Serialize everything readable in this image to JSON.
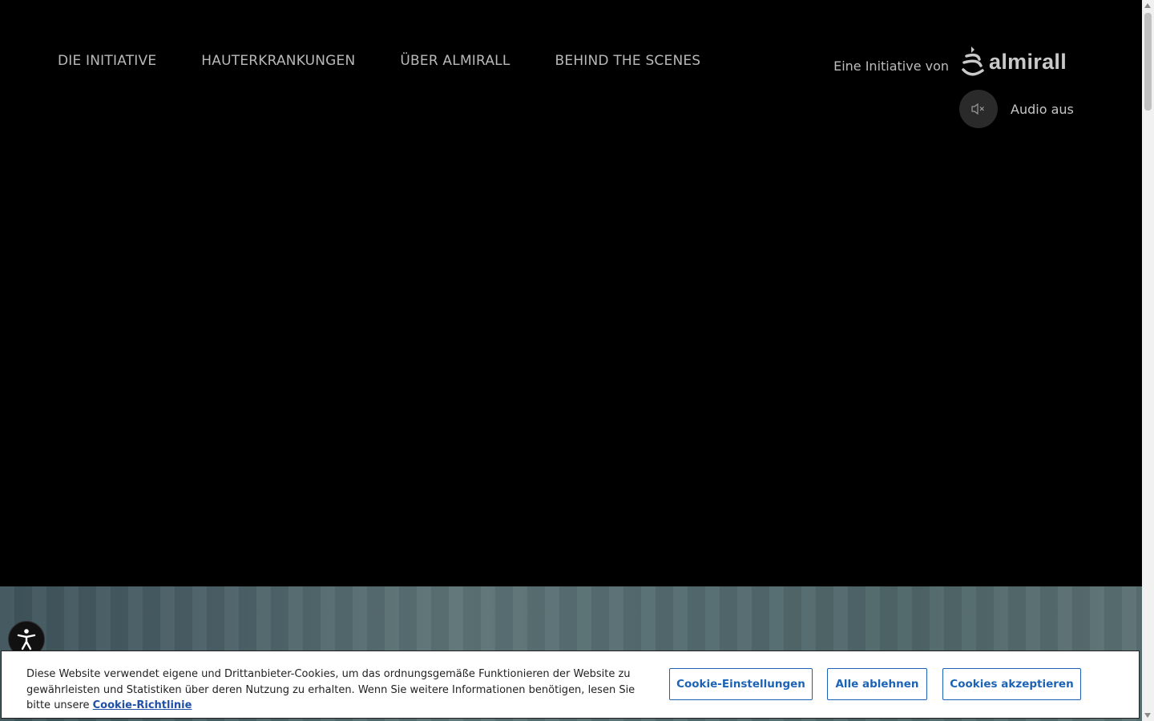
{
  "nav": {
    "items": [
      {
        "label": "DIE INITIATIVE"
      },
      {
        "label": "HAUTERKRANKUNGEN"
      },
      {
        "label": "ÜBER ALMIRALL"
      },
      {
        "label": "BEHIND THE SCENES"
      }
    ]
  },
  "brand": {
    "tagline": "Eine Initiative von",
    "logo_text": "almirall"
  },
  "audio": {
    "label": "Audio aus",
    "icon": "speaker-muted-icon"
  },
  "accessibility": {
    "icon": "accessibility-person-icon"
  },
  "cookie": {
    "text": "Diese Website verwendet eigene und Drittanbieter-Cookies, um das ordnungsgemäße Funktionieren der Website zu gewährleisten und Statistiken über deren Nutzung zu erhalten. Wenn Sie weitere Informationen benötigen, lesen Sie bitte unsere ",
    "link": "Cookie-Richtlinie",
    "settings_label": "Cookie-Einstellungen",
    "reject_label": "Alle ablehnen",
    "accept_label": "Cookies akzeptieren"
  },
  "colors": {
    "background": "#000000",
    "nav_text": "#b9b9b9",
    "button_accent": "#1d63b5"
  }
}
